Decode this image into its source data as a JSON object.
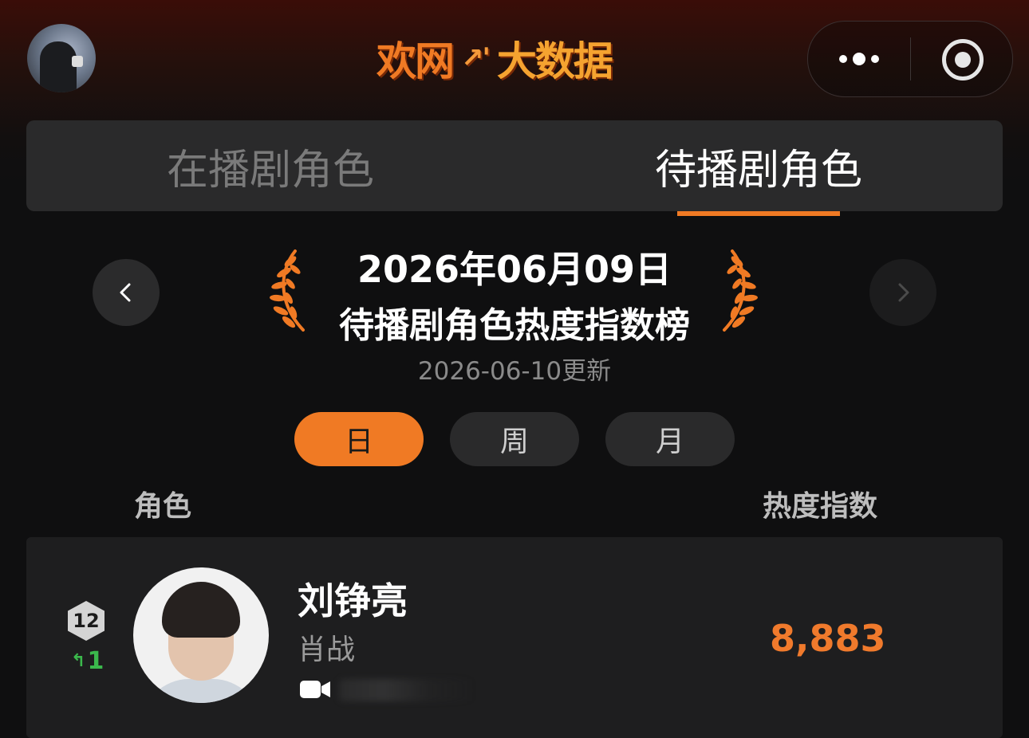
{
  "header": {
    "logo_part1": "欢网",
    "logo_mark": "↗'",
    "logo_part2": "大数据",
    "more_icon": "more-dots-icon",
    "close_icon": "target-circle-icon"
  },
  "tabs": [
    {
      "label": "在播剧角色",
      "active": false
    },
    {
      "label": "待播剧角色",
      "active": true
    }
  ],
  "title": {
    "date": "2026年06月09日",
    "name": "待播剧角色热度指数榜",
    "updated": "2026-06-10更新"
  },
  "periods": [
    {
      "label": "日",
      "active": true
    },
    {
      "label": "周",
      "active": false
    },
    {
      "label": "月",
      "active": false
    }
  ],
  "columns": {
    "role": "角色",
    "heat": "热度指数"
  },
  "rows": [
    {
      "rank": "12",
      "rank_change": "1",
      "role_name": "刘铮亮",
      "actor": "肖战",
      "heat": "8,883"
    }
  ],
  "colors": {
    "accent": "#f07a24",
    "rise": "#3bb84c",
    "background": "#0f0f10"
  }
}
